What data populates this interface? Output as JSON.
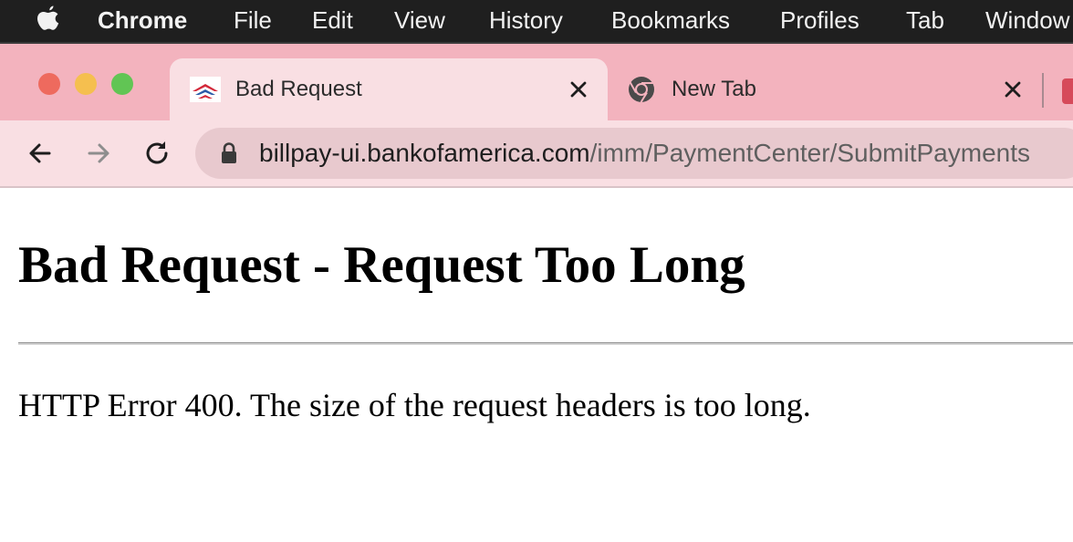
{
  "menubar": {
    "app_name": "Chrome",
    "items": [
      "File",
      "Edit",
      "View",
      "History",
      "Bookmarks",
      "Profiles",
      "Tab",
      "Window"
    ],
    "apple_icon": "apple-logo-icon"
  },
  "tabs": [
    {
      "title": "Bad Request",
      "favicon": "bank-of-america-icon",
      "active": true
    },
    {
      "title": "New Tab",
      "favicon": "chrome-icon",
      "active": false
    }
  ],
  "toolbar": {
    "url_host": "billpay-ui.bankofamerica.com",
    "url_path": "/imm/PaymentCenter/SubmitPayments",
    "icons": [
      "back-arrow-icon",
      "forward-arrow-icon",
      "reload-icon",
      "lock-icon"
    ]
  },
  "page": {
    "heading": "Bad Request - Request Too Long",
    "message": "HTTP Error 400. The size of the request headers is too long."
  },
  "colors": {
    "menubar_bg": "#1f1f1f",
    "tabstrip_bg": "#f3b3be",
    "active_tab_bg": "#f9dfe3",
    "omnibox_bg": "#e8c9ce"
  }
}
